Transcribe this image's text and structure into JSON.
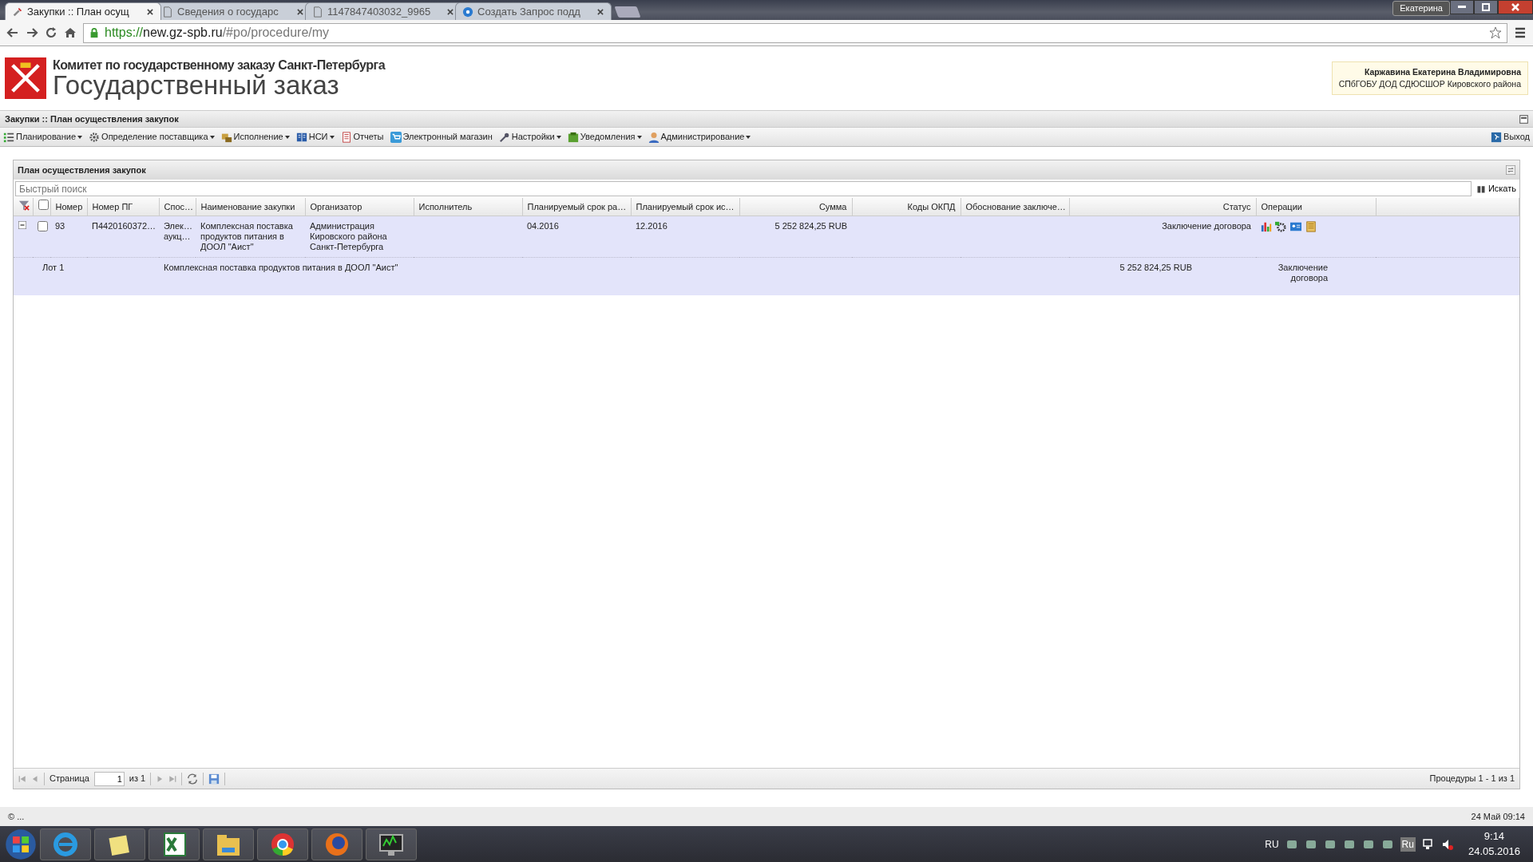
{
  "browser": {
    "tabs": [
      {
        "title": "Закупки :: План осущ",
        "selected": true
      },
      {
        "title": "Сведения о государс",
        "selected": false
      },
      {
        "title": "1147847403032_9965",
        "selected": false
      },
      {
        "title": "Создать Запрос подд",
        "selected": false
      }
    ],
    "profile": "Екатерина",
    "address": {
      "scheme": "https://",
      "host": "new.gz-spb.ru",
      "path": "/#po/procedure/my"
    }
  },
  "header": {
    "subtitle": "Комитет по государственному заказу Санкт-Петербурга",
    "title": "Государственный заказ",
    "user": {
      "name": "Каржавина Екатерина Владимировна",
      "org": "СПбГОБУ ДОД СДЮСШОР Кировского района"
    }
  },
  "section_title": "Закупки :: План осуществления закупок",
  "menu": [
    {
      "label": "Планирование",
      "dropdown": true
    },
    {
      "label": "Определение поставщика",
      "dropdown": true
    },
    {
      "label": "Исполнение",
      "dropdown": true
    },
    {
      "label": "НСИ",
      "dropdown": true
    },
    {
      "label": "Отчеты",
      "dropdown": false
    },
    {
      "label": "Электронный магазин",
      "dropdown": false
    },
    {
      "label": "Настройки",
      "dropdown": true
    },
    {
      "label": "Уведомления",
      "dropdown": true
    },
    {
      "label": "Администрирование",
      "dropdown": true
    }
  ],
  "logout": "Выход",
  "grid": {
    "title": "План осуществления закупок",
    "search": {
      "placeholder": "Быстрый поиск",
      "button": "Искать"
    },
    "select_all_checked": false,
    "columns": [
      "Номер",
      "Номер ПГ",
      "Спос…",
      "Наименование закупки",
      "Организатор",
      "Исполнитель",
      "Планируемый срок ра…",
      "Планируемый срок ис…",
      "Сумма",
      "Коды ОКПД",
      "Обоснование заключе…",
      "Статус",
      "Операции"
    ],
    "rows": [
      {
        "expanded": true,
        "checked": false,
        "number": "93",
        "plan_number": "П4420160372…",
        "method": "Элек… аукц…",
        "name": "Комплексная поставка продуктов питания в ДООЛ \"Аист\"",
        "organizer": "Администрация Кировского района Санкт-Петербурга",
        "start": "04.2016",
        "end": "12.2016",
        "sum": "5 252 824,25 RUB",
        "status": "Заключение договора",
        "lots": [
          {
            "label": "Лот 1",
            "name": "Комплексная поставка продуктов питания в ДООЛ \"Аист\"",
            "sum": "5 252 824,25 RUB",
            "status": "Заключение договора"
          }
        ]
      }
    ],
    "pager": {
      "page_label": "Страница",
      "page": "1",
      "of": "из 1",
      "summary": "Процедуры 1 - 1 из 1"
    }
  },
  "status_bar": {
    "left": "© ...",
    "right": "24 Май 09:14"
  },
  "taskbar": {
    "language": "RU",
    "tray_language": "Ru",
    "time": "9:14",
    "date": "24.05.2016"
  }
}
